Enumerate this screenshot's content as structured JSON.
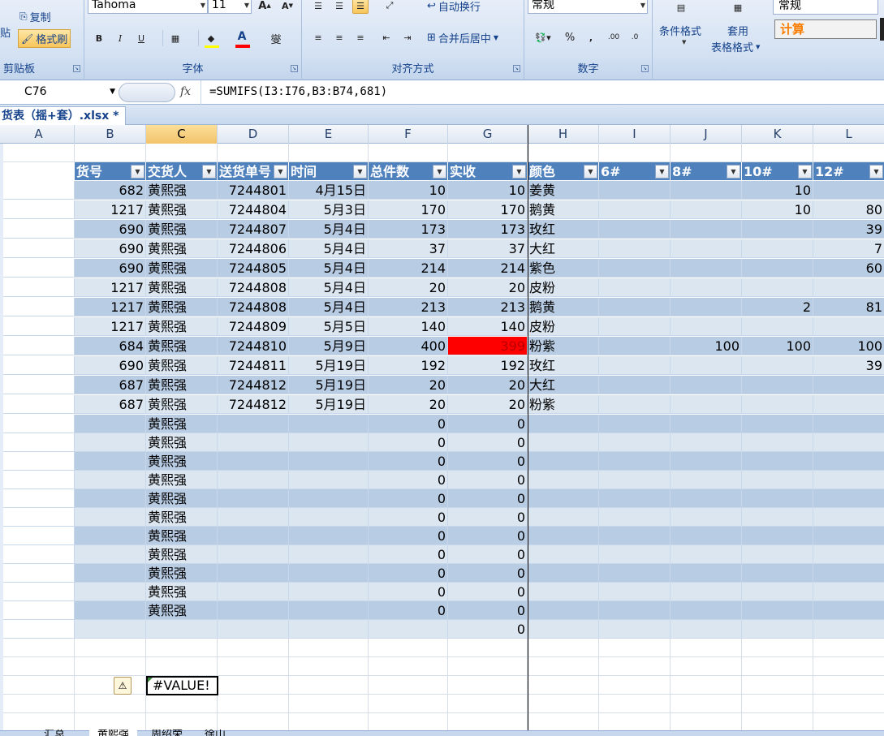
{
  "ribbon": {
    "clipboard": {
      "paste_char": "贴",
      "copy_label": "复制",
      "format_painter_label": "格式刷",
      "group_label": "剪贴板"
    },
    "font": {
      "font_name": "Tahoma",
      "font_size": "11",
      "bold": "B",
      "italic": "I",
      "underline": "U",
      "font_color_letter": "A",
      "wen": "燮",
      "group_label": "字体"
    },
    "alignment": {
      "wrap_label": "自动换行",
      "merge_label": "合并后居中",
      "group_label": "对齐方式"
    },
    "number": {
      "format": "常规",
      "percent": "%",
      "comma": ",",
      "group_label": "数字"
    },
    "styles": {
      "cond_format_label": "条件格式",
      "table_format_label1": "套用",
      "table_format_label2": "表格格式",
      "style_normal": "常规",
      "style_calc": "计算"
    }
  },
  "formula_bar": {
    "name_box": "C76",
    "fx": "fx",
    "formula": "=SUMIFS(I3:I76,B3:B74,681)"
  },
  "workbook_tab": "货表（摇+套）.xlsx *",
  "columns": [
    "A",
    "B",
    "C",
    "D",
    "E",
    "F",
    "G",
    "H",
    "I",
    "J",
    "K",
    "L"
  ],
  "table_headers": [
    "货号",
    "交货人",
    "送货单号",
    "时间",
    "总件数",
    "实收",
    "颜色",
    "6#",
    "8#",
    "10#",
    "12#"
  ],
  "rows": [
    [
      "682",
      "黄熙强",
      "7244801",
      "4月15日",
      "10",
      "10",
      "姜黄",
      "",
      "",
      "10",
      ""
    ],
    [
      "1217",
      "黄熙强",
      "7244804",
      "5月3日",
      "170",
      "170",
      "鹅黄",
      "",
      "",
      "10",
      "80"
    ],
    [
      "690",
      "黄熙强",
      "7244807",
      "5月4日",
      "173",
      "173",
      "玫红",
      "",
      "",
      "",
      "39"
    ],
    [
      "690",
      "黄熙强",
      "7244806",
      "5月4日",
      "37",
      "37",
      "大红",
      "",
      "",
      "",
      "7"
    ],
    [
      "690",
      "黄熙强",
      "7244805",
      "5月4日",
      "214",
      "214",
      "紫色",
      "",
      "",
      "",
      "60"
    ],
    [
      "1217",
      "黄熙强",
      "7244808",
      "5月4日",
      "20",
      "20",
      "皮粉",
      "",
      "",
      "",
      ""
    ],
    [
      "1217",
      "黄熙强",
      "7244808",
      "5月4日",
      "213",
      "213",
      "鹅黄",
      "",
      "",
      "2",
      "81"
    ],
    [
      "1217",
      "黄熙强",
      "7244809",
      "5月5日",
      "140",
      "140",
      "皮粉",
      "",
      "",
      "",
      ""
    ],
    [
      "684",
      "黄熙强",
      "7244810",
      "5月9日",
      "400",
      "399",
      "粉紫",
      "",
      "100",
      "100",
      "100"
    ],
    [
      "690",
      "黄熙强",
      "7244811",
      "5月19日",
      "192",
      "192",
      "玫红",
      "",
      "",
      "",
      "39"
    ],
    [
      "687",
      "黄熙强",
      "7244812",
      "5月19日",
      "20",
      "20",
      "大红",
      "",
      "",
      "",
      ""
    ],
    [
      "687",
      "黄熙强",
      "7244812",
      "5月19日",
      "20",
      "20",
      "粉紫",
      "",
      "",
      "",
      ""
    ],
    [
      "",
      "黄熙强",
      "",
      "",
      "0",
      "0",
      "",
      "",
      "",
      "",
      ""
    ],
    [
      "",
      "黄熙强",
      "",
      "",
      "0",
      "0",
      "",
      "",
      "",
      "",
      ""
    ],
    [
      "",
      "黄熙强",
      "",
      "",
      "0",
      "0",
      "",
      "",
      "",
      "",
      ""
    ],
    [
      "",
      "黄熙强",
      "",
      "",
      "0",
      "0",
      "",
      "",
      "",
      "",
      ""
    ],
    [
      "",
      "黄熙强",
      "",
      "",
      "0",
      "0",
      "",
      "",
      "",
      "",
      ""
    ],
    [
      "",
      "黄熙强",
      "",
      "",
      "0",
      "0",
      "",
      "",
      "",
      "",
      ""
    ],
    [
      "",
      "黄熙强",
      "",
      "",
      "0",
      "0",
      "",
      "",
      "",
      "",
      ""
    ],
    [
      "",
      "黄熙强",
      "",
      "",
      "0",
      "0",
      "",
      "",
      "",
      "",
      ""
    ],
    [
      "",
      "黄熙强",
      "",
      "",
      "0",
      "0",
      "",
      "",
      "",
      "",
      ""
    ],
    [
      "",
      "黄熙强",
      "",
      "",
      "0",
      "0",
      "",
      "",
      "",
      "",
      ""
    ],
    [
      "",
      "黄熙强",
      "",
      "",
      "0",
      "0",
      "",
      "",
      "",
      "",
      ""
    ],
    [
      "",
      "",
      "",
      "",
      "",
      "0",
      "",
      "",
      "",
      "",
      ""
    ]
  ],
  "highlight": {
    "row_index": 8,
    "col_index": 5,
    "color": "#ff0000"
  },
  "error_cell": {
    "value": "#VALUE!",
    "icon": "warning-icon"
  },
  "sheet_tabs": [
    "汇总",
    "黄熙强",
    "周绍荣",
    "徐山"
  ],
  "colors": {
    "table_header": "#4f81bd",
    "band_dark": "#b8cce4",
    "band_light": "#dce6f1",
    "ribbon_text": "#15428b"
  }
}
